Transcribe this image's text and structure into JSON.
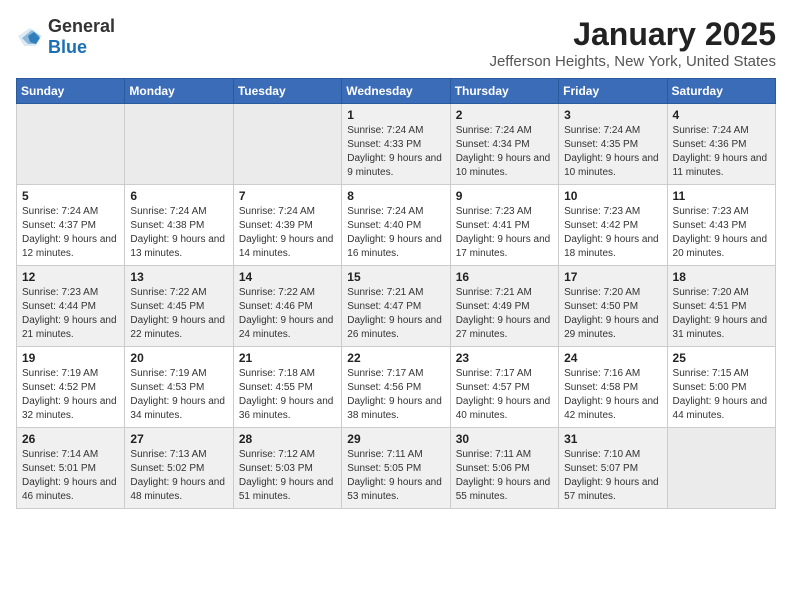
{
  "header": {
    "logo_general": "General",
    "logo_blue": "Blue",
    "month": "January 2025",
    "location": "Jefferson Heights, New York, United States"
  },
  "weekdays": [
    "Sunday",
    "Monday",
    "Tuesday",
    "Wednesday",
    "Thursday",
    "Friday",
    "Saturday"
  ],
  "weeks": [
    [
      {
        "day": "",
        "info": ""
      },
      {
        "day": "",
        "info": ""
      },
      {
        "day": "",
        "info": ""
      },
      {
        "day": "1",
        "info": "Sunrise: 7:24 AM\nSunset: 4:33 PM\nDaylight: 9 hours and 9 minutes."
      },
      {
        "day": "2",
        "info": "Sunrise: 7:24 AM\nSunset: 4:34 PM\nDaylight: 9 hours and 10 minutes."
      },
      {
        "day": "3",
        "info": "Sunrise: 7:24 AM\nSunset: 4:35 PM\nDaylight: 9 hours and 10 minutes."
      },
      {
        "day": "4",
        "info": "Sunrise: 7:24 AM\nSunset: 4:36 PM\nDaylight: 9 hours and 11 minutes."
      }
    ],
    [
      {
        "day": "5",
        "info": "Sunrise: 7:24 AM\nSunset: 4:37 PM\nDaylight: 9 hours and 12 minutes."
      },
      {
        "day": "6",
        "info": "Sunrise: 7:24 AM\nSunset: 4:38 PM\nDaylight: 9 hours and 13 minutes."
      },
      {
        "day": "7",
        "info": "Sunrise: 7:24 AM\nSunset: 4:39 PM\nDaylight: 9 hours and 14 minutes."
      },
      {
        "day": "8",
        "info": "Sunrise: 7:24 AM\nSunset: 4:40 PM\nDaylight: 9 hours and 16 minutes."
      },
      {
        "day": "9",
        "info": "Sunrise: 7:23 AM\nSunset: 4:41 PM\nDaylight: 9 hours and 17 minutes."
      },
      {
        "day": "10",
        "info": "Sunrise: 7:23 AM\nSunset: 4:42 PM\nDaylight: 9 hours and 18 minutes."
      },
      {
        "day": "11",
        "info": "Sunrise: 7:23 AM\nSunset: 4:43 PM\nDaylight: 9 hours and 20 minutes."
      }
    ],
    [
      {
        "day": "12",
        "info": "Sunrise: 7:23 AM\nSunset: 4:44 PM\nDaylight: 9 hours and 21 minutes."
      },
      {
        "day": "13",
        "info": "Sunrise: 7:22 AM\nSunset: 4:45 PM\nDaylight: 9 hours and 22 minutes."
      },
      {
        "day": "14",
        "info": "Sunrise: 7:22 AM\nSunset: 4:46 PM\nDaylight: 9 hours and 24 minutes."
      },
      {
        "day": "15",
        "info": "Sunrise: 7:21 AM\nSunset: 4:47 PM\nDaylight: 9 hours and 26 minutes."
      },
      {
        "day": "16",
        "info": "Sunrise: 7:21 AM\nSunset: 4:49 PM\nDaylight: 9 hours and 27 minutes."
      },
      {
        "day": "17",
        "info": "Sunrise: 7:20 AM\nSunset: 4:50 PM\nDaylight: 9 hours and 29 minutes."
      },
      {
        "day": "18",
        "info": "Sunrise: 7:20 AM\nSunset: 4:51 PM\nDaylight: 9 hours and 31 minutes."
      }
    ],
    [
      {
        "day": "19",
        "info": "Sunrise: 7:19 AM\nSunset: 4:52 PM\nDaylight: 9 hours and 32 minutes."
      },
      {
        "day": "20",
        "info": "Sunrise: 7:19 AM\nSunset: 4:53 PM\nDaylight: 9 hours and 34 minutes."
      },
      {
        "day": "21",
        "info": "Sunrise: 7:18 AM\nSunset: 4:55 PM\nDaylight: 9 hours and 36 minutes."
      },
      {
        "day": "22",
        "info": "Sunrise: 7:17 AM\nSunset: 4:56 PM\nDaylight: 9 hours and 38 minutes."
      },
      {
        "day": "23",
        "info": "Sunrise: 7:17 AM\nSunset: 4:57 PM\nDaylight: 9 hours and 40 minutes."
      },
      {
        "day": "24",
        "info": "Sunrise: 7:16 AM\nSunset: 4:58 PM\nDaylight: 9 hours and 42 minutes."
      },
      {
        "day": "25",
        "info": "Sunrise: 7:15 AM\nSunset: 5:00 PM\nDaylight: 9 hours and 44 minutes."
      }
    ],
    [
      {
        "day": "26",
        "info": "Sunrise: 7:14 AM\nSunset: 5:01 PM\nDaylight: 9 hours and 46 minutes."
      },
      {
        "day": "27",
        "info": "Sunrise: 7:13 AM\nSunset: 5:02 PM\nDaylight: 9 hours and 48 minutes."
      },
      {
        "day": "28",
        "info": "Sunrise: 7:12 AM\nSunset: 5:03 PM\nDaylight: 9 hours and 51 minutes."
      },
      {
        "day": "29",
        "info": "Sunrise: 7:11 AM\nSunset: 5:05 PM\nDaylight: 9 hours and 53 minutes."
      },
      {
        "day": "30",
        "info": "Sunrise: 7:11 AM\nSunset: 5:06 PM\nDaylight: 9 hours and 55 minutes."
      },
      {
        "day": "31",
        "info": "Sunrise: 7:10 AM\nSunset: 5:07 PM\nDaylight: 9 hours and 57 minutes."
      },
      {
        "day": "",
        "info": ""
      }
    ]
  ]
}
